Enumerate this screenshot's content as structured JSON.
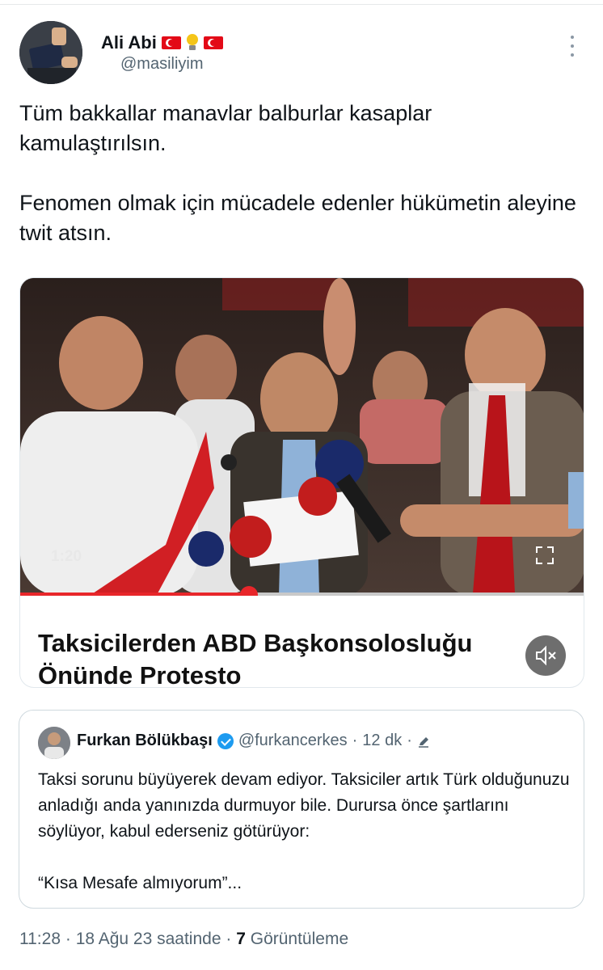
{
  "author": {
    "display_name": "Ali Abi",
    "handle": "@masiliyim",
    "badges": [
      "turkish-flag-emoji",
      "lightbulb-emoji",
      "turkish-flag-emoji"
    ]
  },
  "tweet": {
    "paragraphs": [
      "Tüm bakkallar manavlar balburlar kasaplar kamulaştırılsın.",
      "Fenomen olmak için mücadele edenler hükümetin aleyine twit atsın."
    ]
  },
  "media": {
    "timecode": "1:20",
    "headline": "Taksicilerden ABD Başkonsolosluğu Önünde Protesto",
    "progress": 0.405,
    "icons": [
      "fullscreen-icon",
      "mute-icon"
    ]
  },
  "quote": {
    "display_name": "Furkan Bölükbaşı",
    "handle": "@furkancerkes",
    "time": "12 dk",
    "separator": "·",
    "paragraphs": [
      "Taksi sorunu büyüyerek devam ediyor. Taksiciler artık Türk olduğunuzu anladığı anda yanınızda durmuyor bile. Durursa önce şartlarını söylüyor, kabul ederseniz götürüyor:",
      "“Kısa Mesafe almıyorum”..."
    ]
  },
  "footer": {
    "time": "11:28",
    "date": "18 Ağu 23 saatinde",
    "views_count": "7",
    "views_label": "Görüntüleme",
    "separator": "·"
  },
  "colors": {
    "accent_red": "#e8262a",
    "verified_blue": "#1d9bf0",
    "meta_gray": "#536471"
  }
}
